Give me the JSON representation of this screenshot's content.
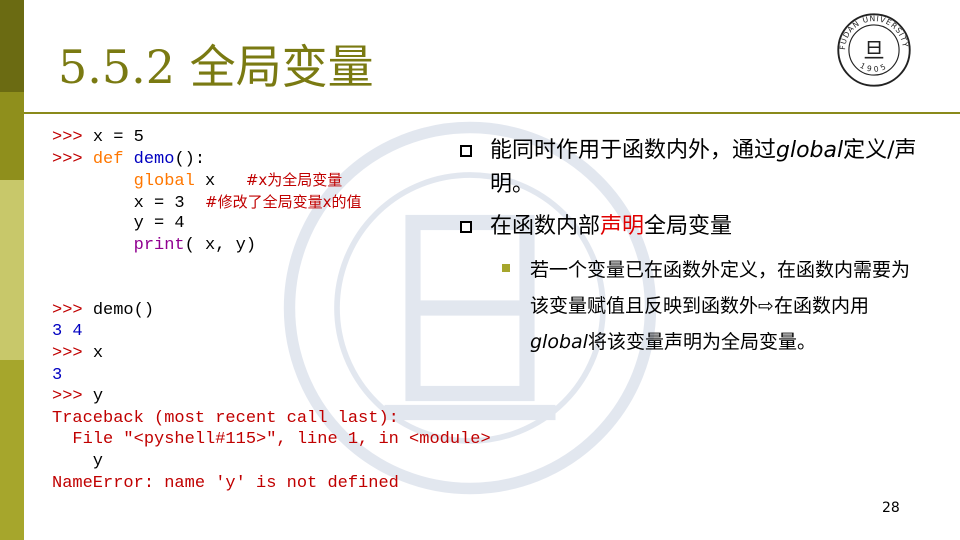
{
  "slide": {
    "title": "5.5.2 全局变量",
    "page_number": "28"
  },
  "code": {
    "line1": {
      "prompt": ">>> ",
      "text": "x = 5"
    },
    "line2": {
      "prompt": ">>> ",
      "kw": "def",
      "name": "demo",
      "rest": "():"
    },
    "line3": {
      "indent": "        ",
      "kw": "global",
      "rest": " x",
      "comment": "#x为全局变量"
    },
    "line4": {
      "text": "        x = 3",
      "comment": "#修改了全局变量x的值"
    },
    "line5": {
      "text": "        y = 4"
    },
    "line6": {
      "indent": "        ",
      "fn": "print",
      "rest": "( x, y)"
    },
    "line7": {
      "prompt": ">>> ",
      "text": "demo()"
    },
    "line8": {
      "output": "3 4"
    },
    "line9": {
      "prompt": ">>> ",
      "text": "x"
    },
    "line10": {
      "output": "3"
    },
    "line11": {
      "prompt": ">>> ",
      "text": "y"
    },
    "line12": {
      "error": "Traceback (most recent call last):"
    },
    "line13": {
      "error": "  File \"<pyshell#115>\", line 1, in <module>"
    },
    "line14": {
      "text": "    y"
    },
    "line15": {
      "error": "NameError: name 'y' is not defined"
    }
  },
  "bullets": {
    "b1": {
      "part1": "能同时作用于函数内外，通过",
      "italic": "global",
      "part2": "定义/声明。"
    },
    "b2": {
      "part1": "在函数内部",
      "red": "声明",
      "part2": "全局变量"
    },
    "b3": {
      "part1": "若一个变量已在函数外定义，在函数内需要为该变量赋值且反映到函数外",
      "arrow": "⇨",
      "part2": "在函数内用",
      "italic": "global",
      "part3": "将该变量声明为全局变量。"
    }
  },
  "colors": {
    "title": "#7a7a12",
    "bar_dark": "#6b6b12",
    "bar_mid": "#8f8f1c",
    "bar_light": "#c8c86a",
    "bar_olive": "#a6a62c",
    "prompt_red": "#c00000",
    "keyword_orange": "#ff7700",
    "builtin_purple": "#900090",
    "output_blue": "#0000c0",
    "emphasis_red": "#e00000"
  },
  "icons": {
    "logo": "fudan-university-seal",
    "watermark": "fudan-university-seal-watermark"
  },
  "seal": {
    "ring_top": "FUDAN UNIVERSITY",
    "glyph": "旦",
    "year": "1905"
  }
}
